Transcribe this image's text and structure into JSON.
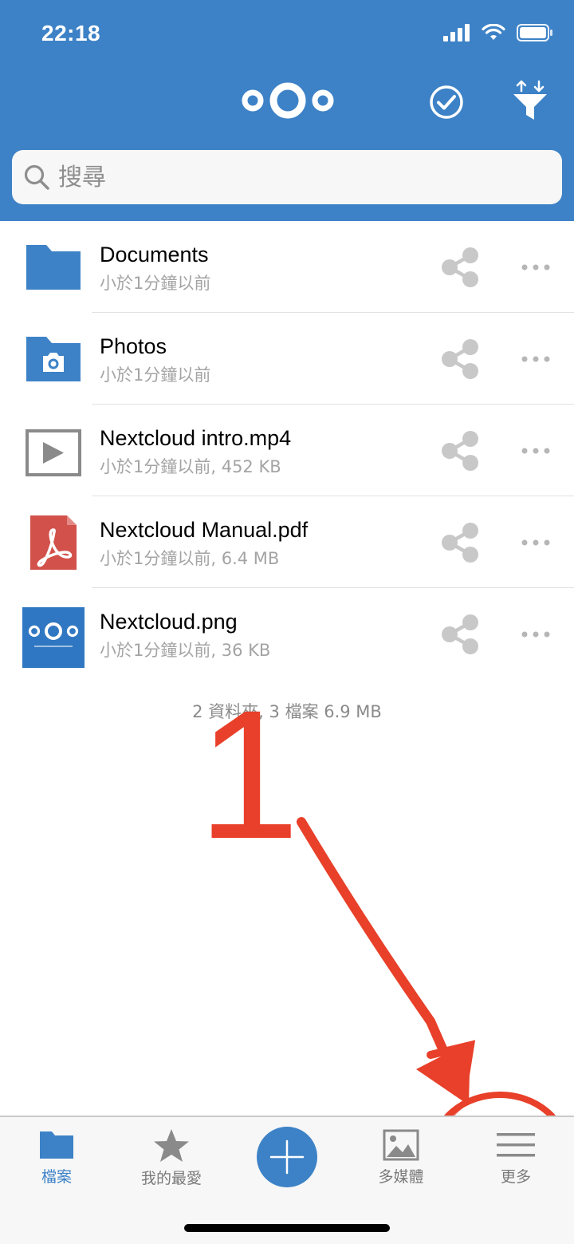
{
  "status_bar": {
    "time": "22:18"
  },
  "header": {
    "search_placeholder": "搜尋"
  },
  "files": [
    {
      "name": "Documents",
      "meta": "小於1分鐘以前",
      "icon": "folder-icon"
    },
    {
      "name": "Photos",
      "meta": "小於1分鐘以前",
      "icon": "photo-folder-icon"
    },
    {
      "name": "Nextcloud intro.mp4",
      "meta": "小於1分鐘以前, 452 KB",
      "icon": "video-file-icon"
    },
    {
      "name": "Nextcloud Manual.pdf",
      "meta": "小於1分鐘以前, 6.4 MB",
      "icon": "pdf-file-icon"
    },
    {
      "name": "Nextcloud.png",
      "meta": "小於1分鐘以前, 36 KB",
      "icon": "image-thumbnail-icon"
    }
  ],
  "summary": "2 資料夾, 3 檔案 6.9 MB",
  "annotation": {
    "number": "1"
  },
  "tabs": [
    {
      "label": "檔案",
      "icon": "folder-icon",
      "active": true
    },
    {
      "label": "我的最愛",
      "icon": "star-icon",
      "active": false
    },
    {
      "label": "多媒體",
      "icon": "media-icon",
      "active": false
    },
    {
      "label": "更多",
      "icon": "menu-icon",
      "active": false
    }
  ],
  "colors": {
    "brand": "#3d82c7",
    "annotation": "#e8402a"
  }
}
